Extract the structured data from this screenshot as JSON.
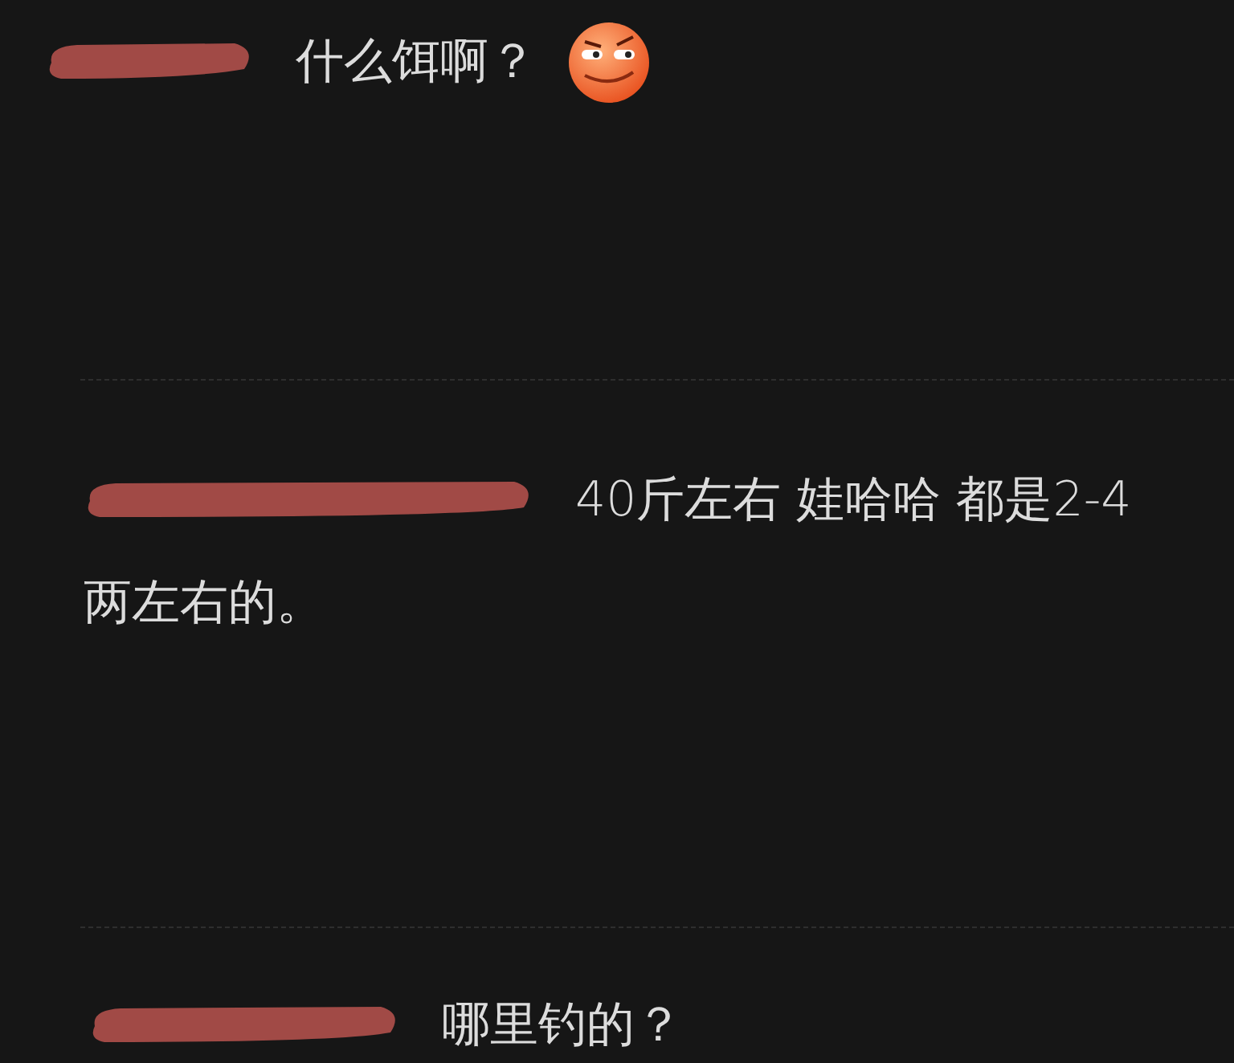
{
  "comments": [
    {
      "text_lines": [
        "什么饵啊？"
      ],
      "emoji": true
    },
    {
      "text_lines": [
        "40斤左右 娃哈哈 都是2-4",
        "两左右的。"
      ],
      "emoji": false
    },
    {
      "text_lines": [
        "哪里钓的？"
      ],
      "emoji": false
    }
  ]
}
